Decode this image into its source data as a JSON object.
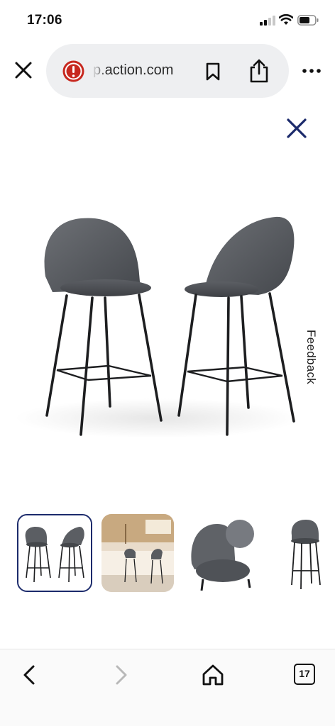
{
  "status_bar": {
    "time": "17:06",
    "signal_icon": "cellular-signal-icon",
    "wifi_icon": "wifi-icon",
    "battery_icon": "battery-icon"
  },
  "browser": {
    "url": "p.action.com",
    "site_warning_icon": "alert-icon",
    "close_icon": "close-icon",
    "bookmark_icon": "bookmark-icon",
    "share_icon": "share-icon",
    "more_icon": "more-icon"
  },
  "gallery": {
    "close_icon": "close-icon",
    "close_color": "#1b2a6b",
    "main_image": "two grey velvet bar stools with black metal legs",
    "feedback_label": "Feedback",
    "thumbnails": [
      {
        "name": "two-bar-stools",
        "selected": true
      },
      {
        "name": "bar-stools-in-kitchen",
        "selected": false
      },
      {
        "name": "stool-back-and-seat-detail",
        "selected": false
      },
      {
        "name": "single-bar-stool",
        "selected": false
      }
    ]
  },
  "bottom_nav": {
    "back_icon": "chevron-left-icon",
    "forward_icon": "chevron-right-icon",
    "home_icon": "home-icon",
    "tab_count": "17"
  }
}
